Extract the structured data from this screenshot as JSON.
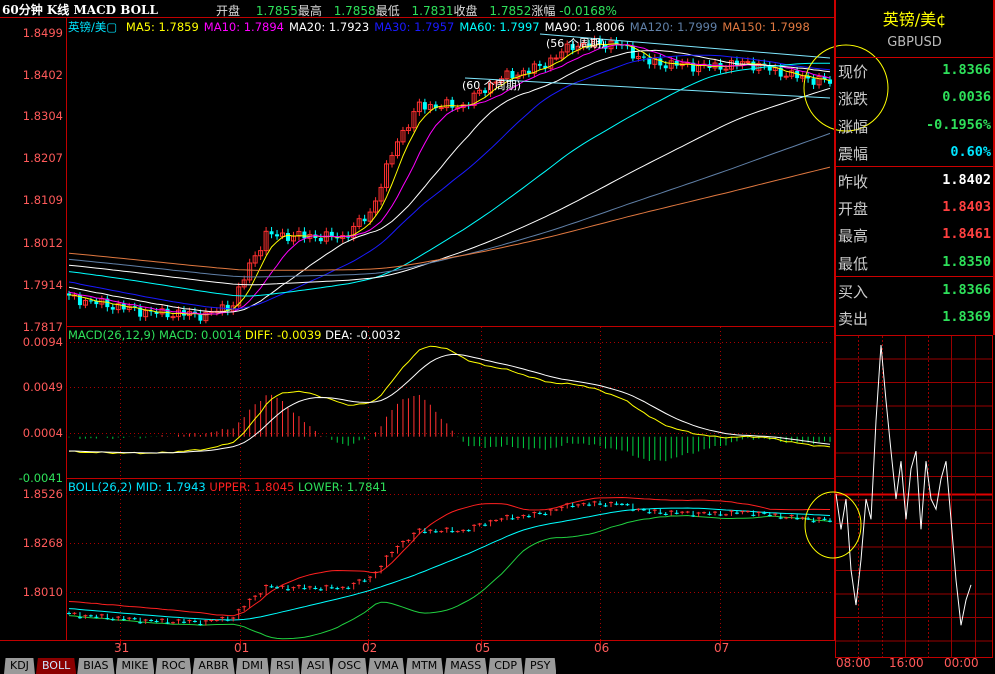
{
  "header": {
    "title": "60分钟 K线 MACD BOLL",
    "open_label": "开盘",
    "open": "1.7855",
    "high_label": "最高",
    "high": "1.7858",
    "low_label": "最低",
    "low": "1.7831",
    "close_label": "收盘",
    "close": "1.7852",
    "change_label": "涨幅",
    "change": "-0.0168%"
  },
  "main": {
    "symbol_label": "英镑/美▢",
    "ma": [
      {
        "label": "MA5: 1.7859",
        "color": "#ffff00",
        "n": 5
      },
      {
        "label": "MA10: 1.7894",
        "color": "#ff00ff",
        "n": 10
      },
      {
        "label": "MA20: 1.7923",
        "color": "#ffffff",
        "n": 20
      },
      {
        "label": "MA30: 1.7957",
        "color": "#1a1aff",
        "n": 30
      },
      {
        "label": "MA60: 1.7997",
        "color": "#00ffff",
        "n": 60
      },
      {
        "label": "MA90: 1.8006",
        "color": "#ffffff",
        "n": 90
      },
      {
        "label": "MA120: 1.7999",
        "color": "#6080a8",
        "n": 120
      },
      {
        "label": "MA150: 1.7998",
        "color": "#e07840",
        "n": 150
      }
    ],
    "axis": [
      "1.8499",
      "1.8402",
      "1.8304",
      "1.8207",
      "1.8109",
      "1.8012",
      "1.7914",
      "1.7817"
    ],
    "annotations": [
      "(56 个周期)",
      "(60 个周期)"
    ]
  },
  "macd": {
    "title": "MACD(26,12,9)",
    "macd": "MACD: 0.0014",
    "diff": "DIFF: -0.0039",
    "dea": "DEA: -0.0032",
    "axis": [
      "0.0094",
      "0.0049",
      "0.0004",
      "-0.0041"
    ]
  },
  "boll": {
    "title": "BOLL(26,2)",
    "mid": "MID: 1.7943",
    "upper": "UPPER: 1.8045",
    "lower": "LOWER: 1.7841",
    "axis": [
      "1.8526",
      "1.8268",
      "1.8010"
    ]
  },
  "dates": [
    "31",
    "01",
    "02",
    "05",
    "06",
    "07"
  ],
  "tabs": [
    "KDJ",
    "BOLL",
    "BIAS",
    "MIKE",
    "ROC",
    "ARBR",
    "DMI",
    "RSI",
    "ASI",
    "OSC",
    "VMA",
    "MTM",
    "MASS",
    "CDP",
    "PSY"
  ],
  "active_tab": "BOLL",
  "quote": {
    "name": "英镑/美¢",
    "code": "GBPUSD",
    "rows": [
      {
        "k": "现价",
        "v": "1.8366",
        "c": "#2ee05a"
      },
      {
        "k": "涨跌",
        "v": "0.0036",
        "c": "#2ee05a"
      },
      {
        "k": "涨幅",
        "v": "-0.1956%",
        "c": "#2ee05a"
      },
      {
        "k": "震幅",
        "v": "0.60%",
        "c": "#00e5ff"
      },
      {
        "k": "昨收",
        "v": "1.8402",
        "c": "#ffffff"
      },
      {
        "k": "开盘",
        "v": "1.8403",
        "c": "#ff4040"
      },
      {
        "k": "最高",
        "v": "1.8461",
        "c": "#ff4040"
      },
      {
        "k": "最低",
        "v": "1.8350",
        "c": "#2ee05a"
      },
      {
        "k": "买入",
        "v": "1.8366",
        "c": "#2ee05a"
      },
      {
        "k": "卖出",
        "v": "1.8369",
        "c": "#2ee05a"
      }
    ]
  },
  "intraday": {
    "times": [
      "08:00",
      "16:00",
      "00:00"
    ],
    "prev_close": 1.8402,
    "prices": [
      1.8402,
      1.8388,
      1.84,
      1.8372,
      1.8358,
      1.8376,
      1.84,
      1.8392,
      1.8431,
      1.8461,
      1.8439,
      1.8419,
      1.84,
      1.8415,
      1.8392,
      1.8412,
      1.8419,
      1.8388,
      1.8415,
      1.84,
      1.8396,
      1.8408,
      1.8415,
      1.8392,
      1.8368,
      1.835,
      1.836,
      1.8366
    ]
  },
  "chart_data": {
    "type": "candlestick",
    "bars": 140,
    "history_keypoints": [
      [
        0,
        1.806
      ],
      [
        60,
        1.8
      ],
      [
        120,
        1.796
      ],
      [
        150,
        1.7885
      ]
    ],
    "close_keypoints": [
      [
        0,
        1.7885
      ],
      [
        15,
        1.785
      ],
      [
        25,
        1.7845
      ],
      [
        30,
        1.787
      ],
      [
        33,
        1.796
      ],
      [
        36,
        1.803
      ],
      [
        50,
        1.8025
      ],
      [
        55,
        1.808
      ],
      [
        60,
        1.825
      ],
      [
        64,
        1.833
      ],
      [
        72,
        1.833
      ],
      [
        78,
        1.839
      ],
      [
        86,
        1.842
      ],
      [
        92,
        1.847
      ],
      [
        100,
        1.8475
      ],
      [
        106,
        1.843
      ],
      [
        118,
        1.842
      ],
      [
        124,
        1.843
      ],
      [
        132,
        1.84
      ],
      [
        139,
        1.8385
      ]
    ],
    "ylim_main": [
      1.7817,
      1.8499
    ],
    "ylim_macd": [
      -0.0041,
      0.0094
    ],
    "ylim_boll": [
      1.7757,
      1.8526
    ]
  }
}
